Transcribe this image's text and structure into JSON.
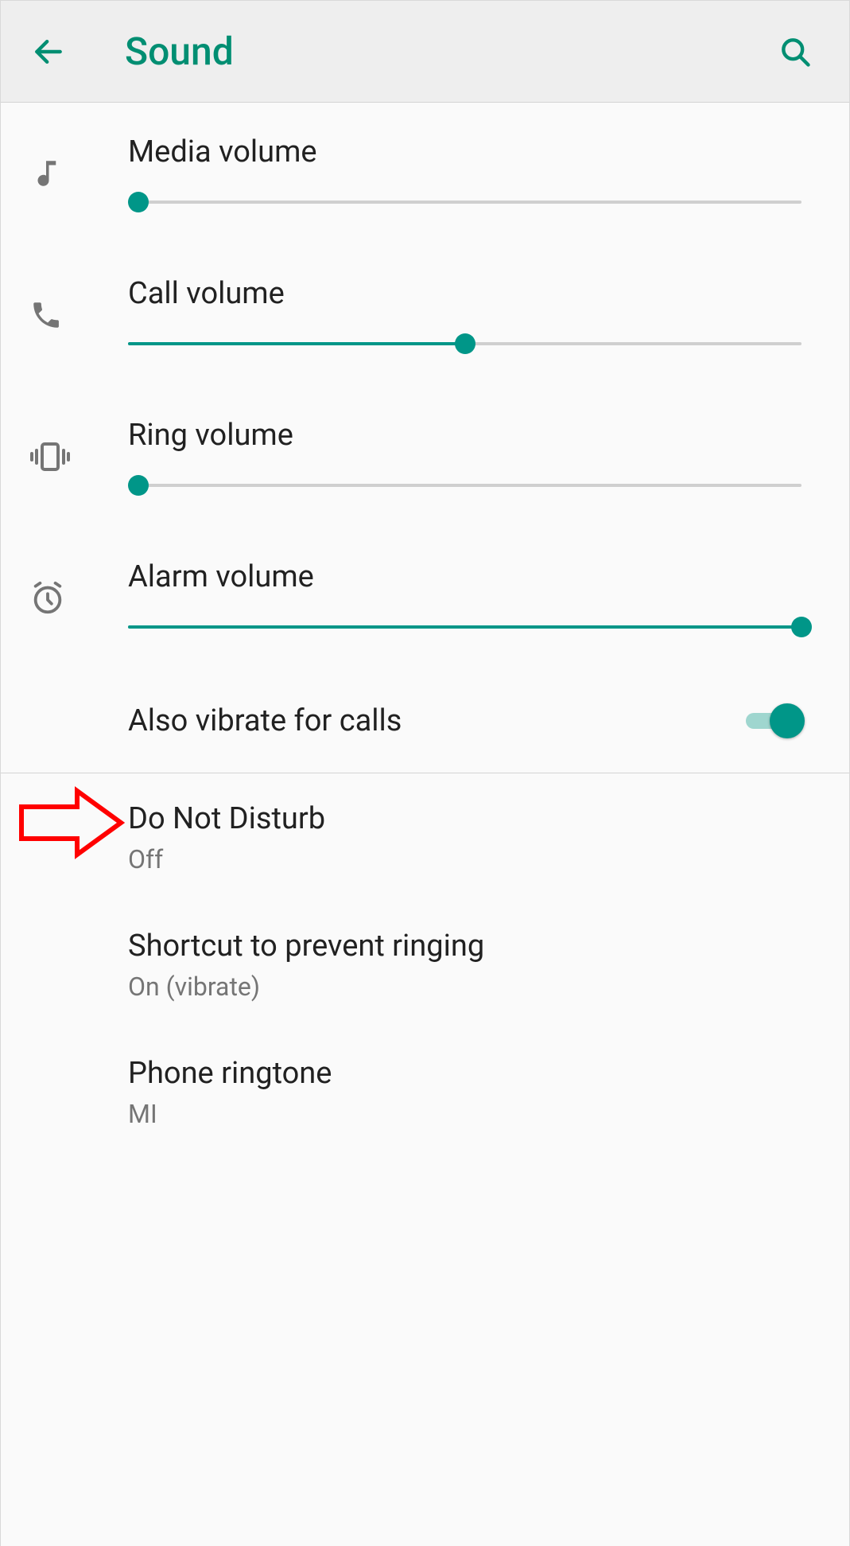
{
  "header": {
    "title": "Sound"
  },
  "sliders": {
    "media": {
      "label": "Media volume",
      "value": 0
    },
    "call": {
      "label": "Call volume",
      "value": 50
    },
    "ring": {
      "label": "Ring volume",
      "value": 0
    },
    "alarm": {
      "label": "Alarm volume",
      "value": 100
    }
  },
  "vibrate": {
    "label": "Also vibrate for calls",
    "on": true
  },
  "items": {
    "dnd": {
      "title": "Do Not Disturb",
      "subtitle": "Off"
    },
    "shortcut": {
      "title": "Shortcut to prevent ringing",
      "subtitle": "On (vibrate)"
    },
    "ringtone": {
      "title": "Phone ringtone",
      "subtitle": "MI"
    }
  },
  "colors": {
    "accent": "#009688",
    "headerText": "#008e72",
    "annotation": "#ff0000"
  }
}
